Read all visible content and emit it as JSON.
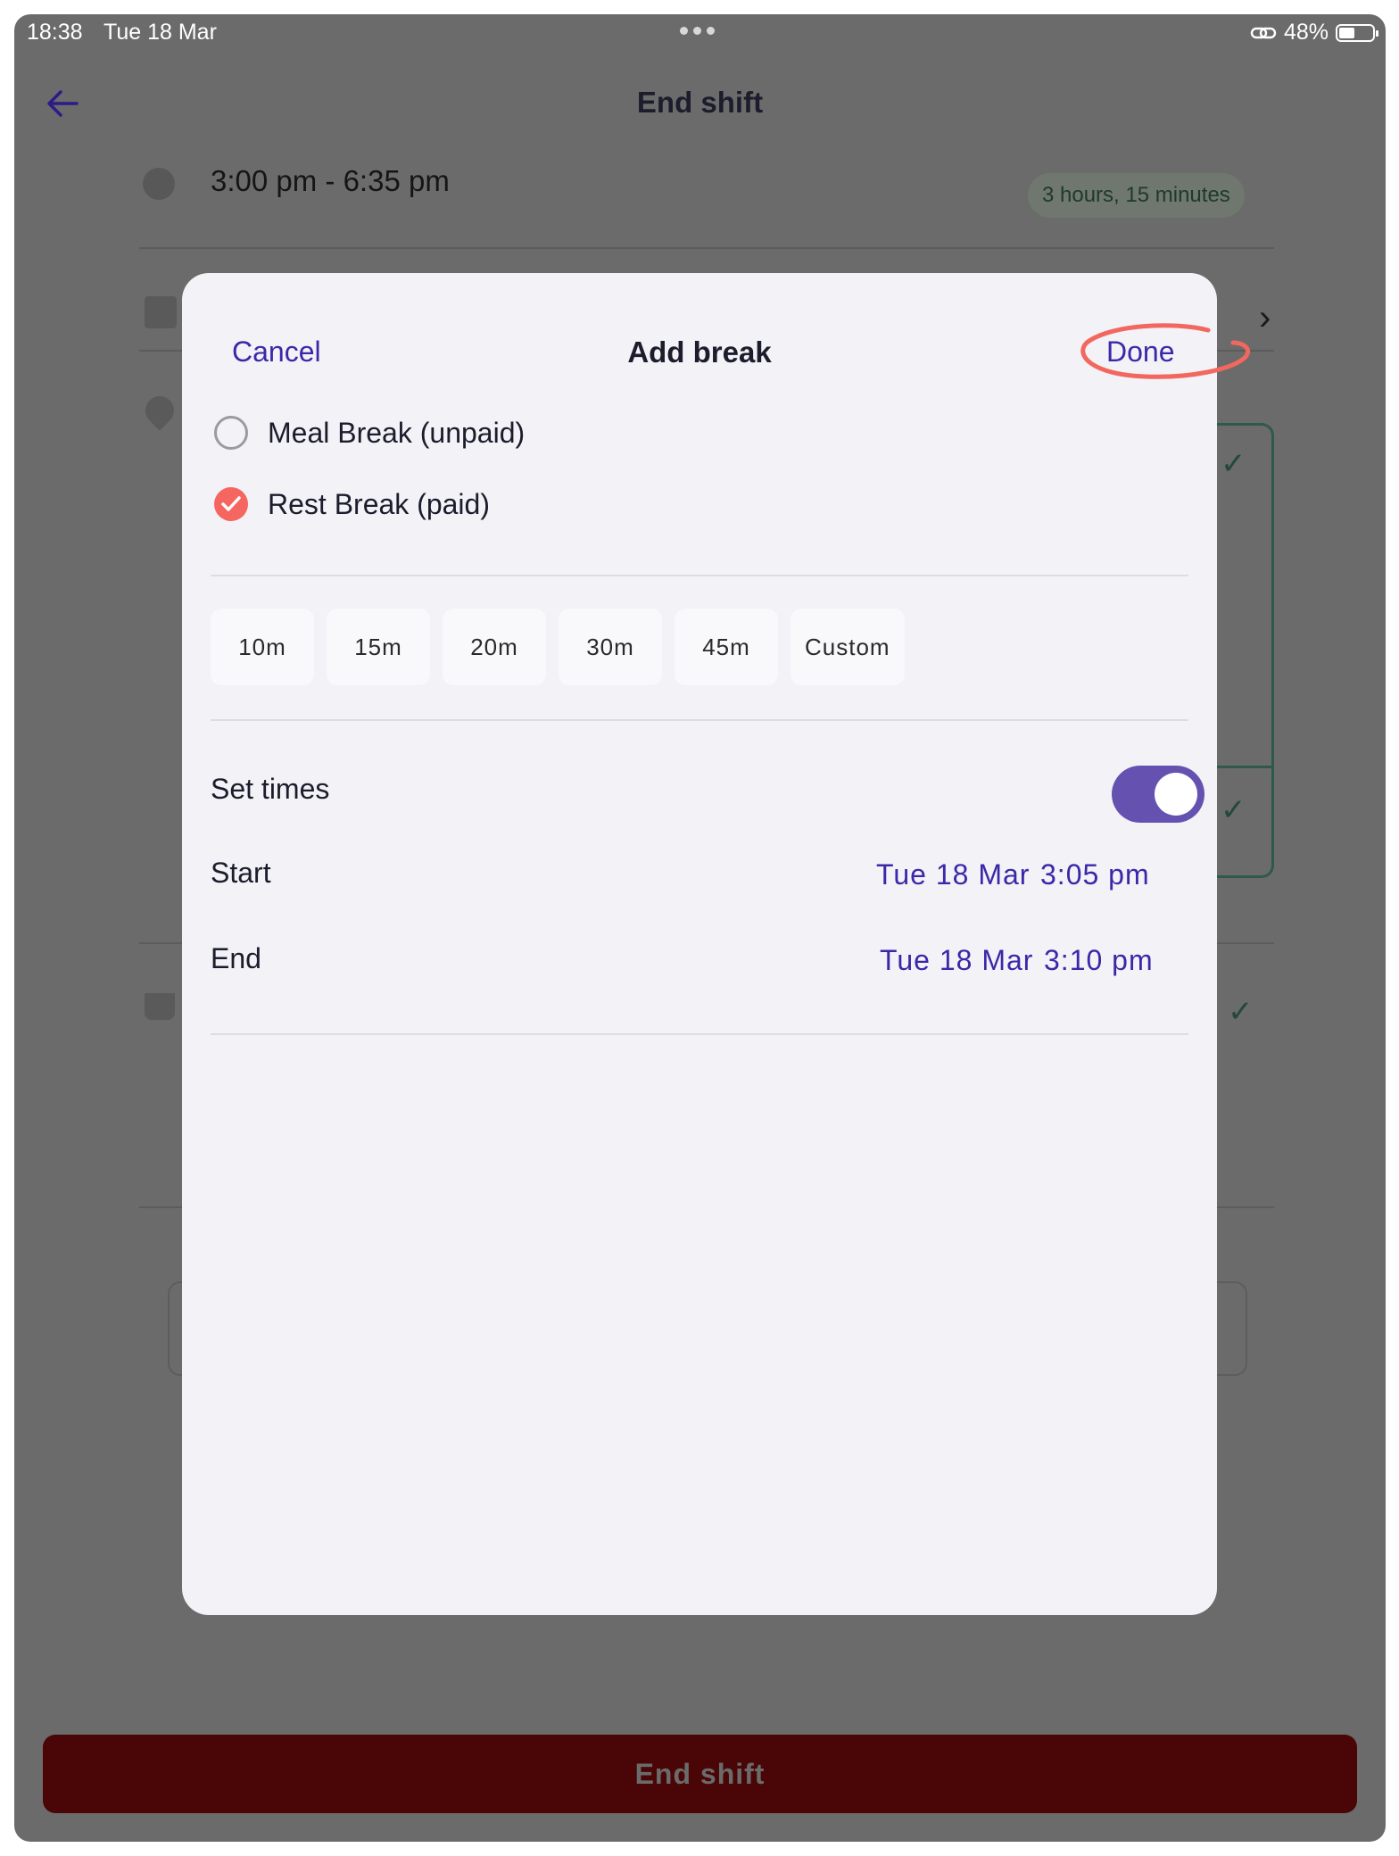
{
  "status_bar": {
    "time": "18:38",
    "date": "Tue 18 Mar",
    "battery": "48%",
    "battery_level": 0.48
  },
  "background": {
    "title": "End shift",
    "shift_time": "3:00 pm - 6:35 pm",
    "duration": "3 hours, 15 minutes",
    "end_button_label": "End shift"
  },
  "modal": {
    "cancel_label": "Cancel",
    "title": "Add break",
    "done_label": "Done",
    "break_types": [
      {
        "label": "Meal Break (unpaid)",
        "selected": false
      },
      {
        "label": "Rest Break (paid)",
        "selected": true
      }
    ],
    "durations": [
      "10m",
      "15m",
      "20m",
      "30m",
      "45m",
      "Custom"
    ],
    "set_times_label": "Set times",
    "set_times_on": true,
    "start_label": "Start",
    "start_date": "Tue 18 Mar",
    "start_time": "3:05 pm",
    "end_label": "End",
    "end_date": "Tue 18 Mar",
    "end_time": "3:10 pm"
  },
  "colors": {
    "accent": "#3b28a8",
    "toggle": "#6552b0",
    "check": "#f4665f",
    "annotation": "#f2685f"
  }
}
